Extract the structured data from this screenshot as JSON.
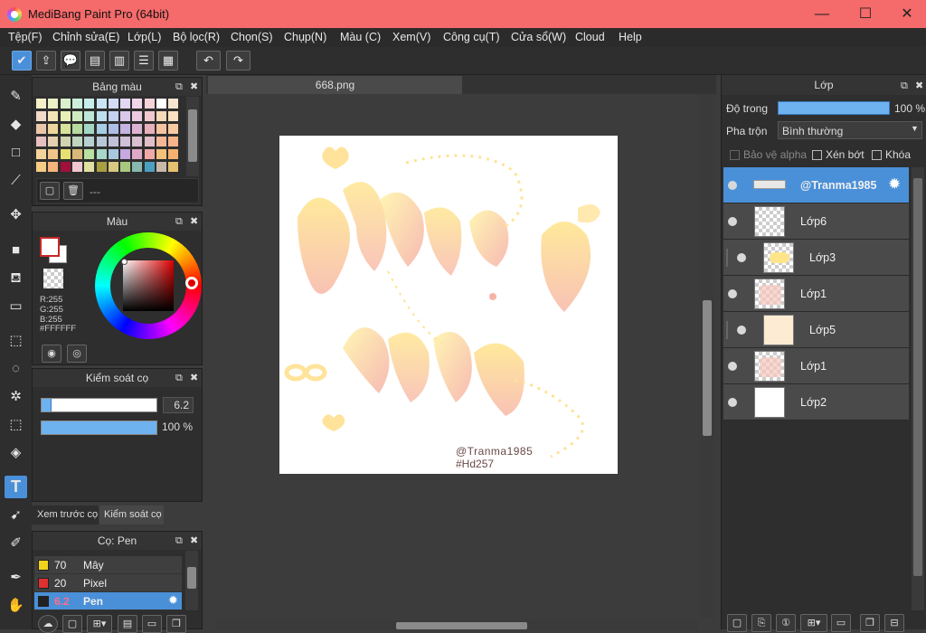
{
  "window": {
    "title": "MediBang Paint Pro (64bit)",
    "minimize": "—",
    "maximize": "☐",
    "close": "✕"
  },
  "menu": [
    "Tệp(F)",
    "Chỉnh sửa(E)",
    "Lớp(L)",
    "Bộ lọc(R)",
    "Chọn(S)",
    "Chụp(N)",
    "Màu (C)",
    "Xem(V)",
    "Công cụ(T)",
    "Cửa sổ(W)",
    "Cloud",
    "Help"
  ],
  "toolbar": {
    "undo": "↶",
    "redo": "↷"
  },
  "palette_panel": {
    "title": "Bảng màu",
    "dashes": "---"
  },
  "color_panel": {
    "title": "Màu",
    "r": "R:255",
    "g": "G:255",
    "b": "B:255",
    "hex": "#FFFFFF"
  },
  "brush_control": {
    "title": "Kiểm soát cọ",
    "size": "6.2",
    "opacity": "100 %",
    "size_fraction": 0.09,
    "opacity_fraction": 1.0
  },
  "bottom_tabs": {
    "preview": "Xem trước cọ",
    "control": "Kiểm soát cọ"
  },
  "brush_panel": {
    "title": "Cọ: Pen",
    "brushes": [
      {
        "size": "70",
        "name": "Mây",
        "color": "#f2d21b"
      },
      {
        "size": "20",
        "name": "Pixel",
        "color": "#e03030"
      },
      {
        "size": "6.2",
        "name": "Pen",
        "color": "#222222"
      }
    ]
  },
  "canvas": {
    "tab": "668.png",
    "signature_line1": "@Tranma1985",
    "signature_line2": "#Hd257"
  },
  "layer_panel": {
    "title": "Lớp",
    "opacity_label": "Độ trong",
    "opacity_value": "100 %",
    "blend_label": "Pha trộn",
    "blend_value": "Bình thường",
    "protect_alpha": "Bảo vệ alpha",
    "clip": "Xén bớt",
    "lock": "Khóa",
    "layers": [
      {
        "name": "@Tranma1985",
        "selected": true
      },
      {
        "name": "Lớp6"
      },
      {
        "name": "Lớp3",
        "indent": true
      },
      {
        "name": "Lớp1"
      },
      {
        "name": "Lớp5",
        "indent": true
      },
      {
        "name": "Lớp1"
      },
      {
        "name": "Lớp2"
      }
    ]
  },
  "colors": {
    "titlebar": "#f56a6a",
    "accent": "#4a90d9",
    "panel": "#2e2e2e"
  }
}
